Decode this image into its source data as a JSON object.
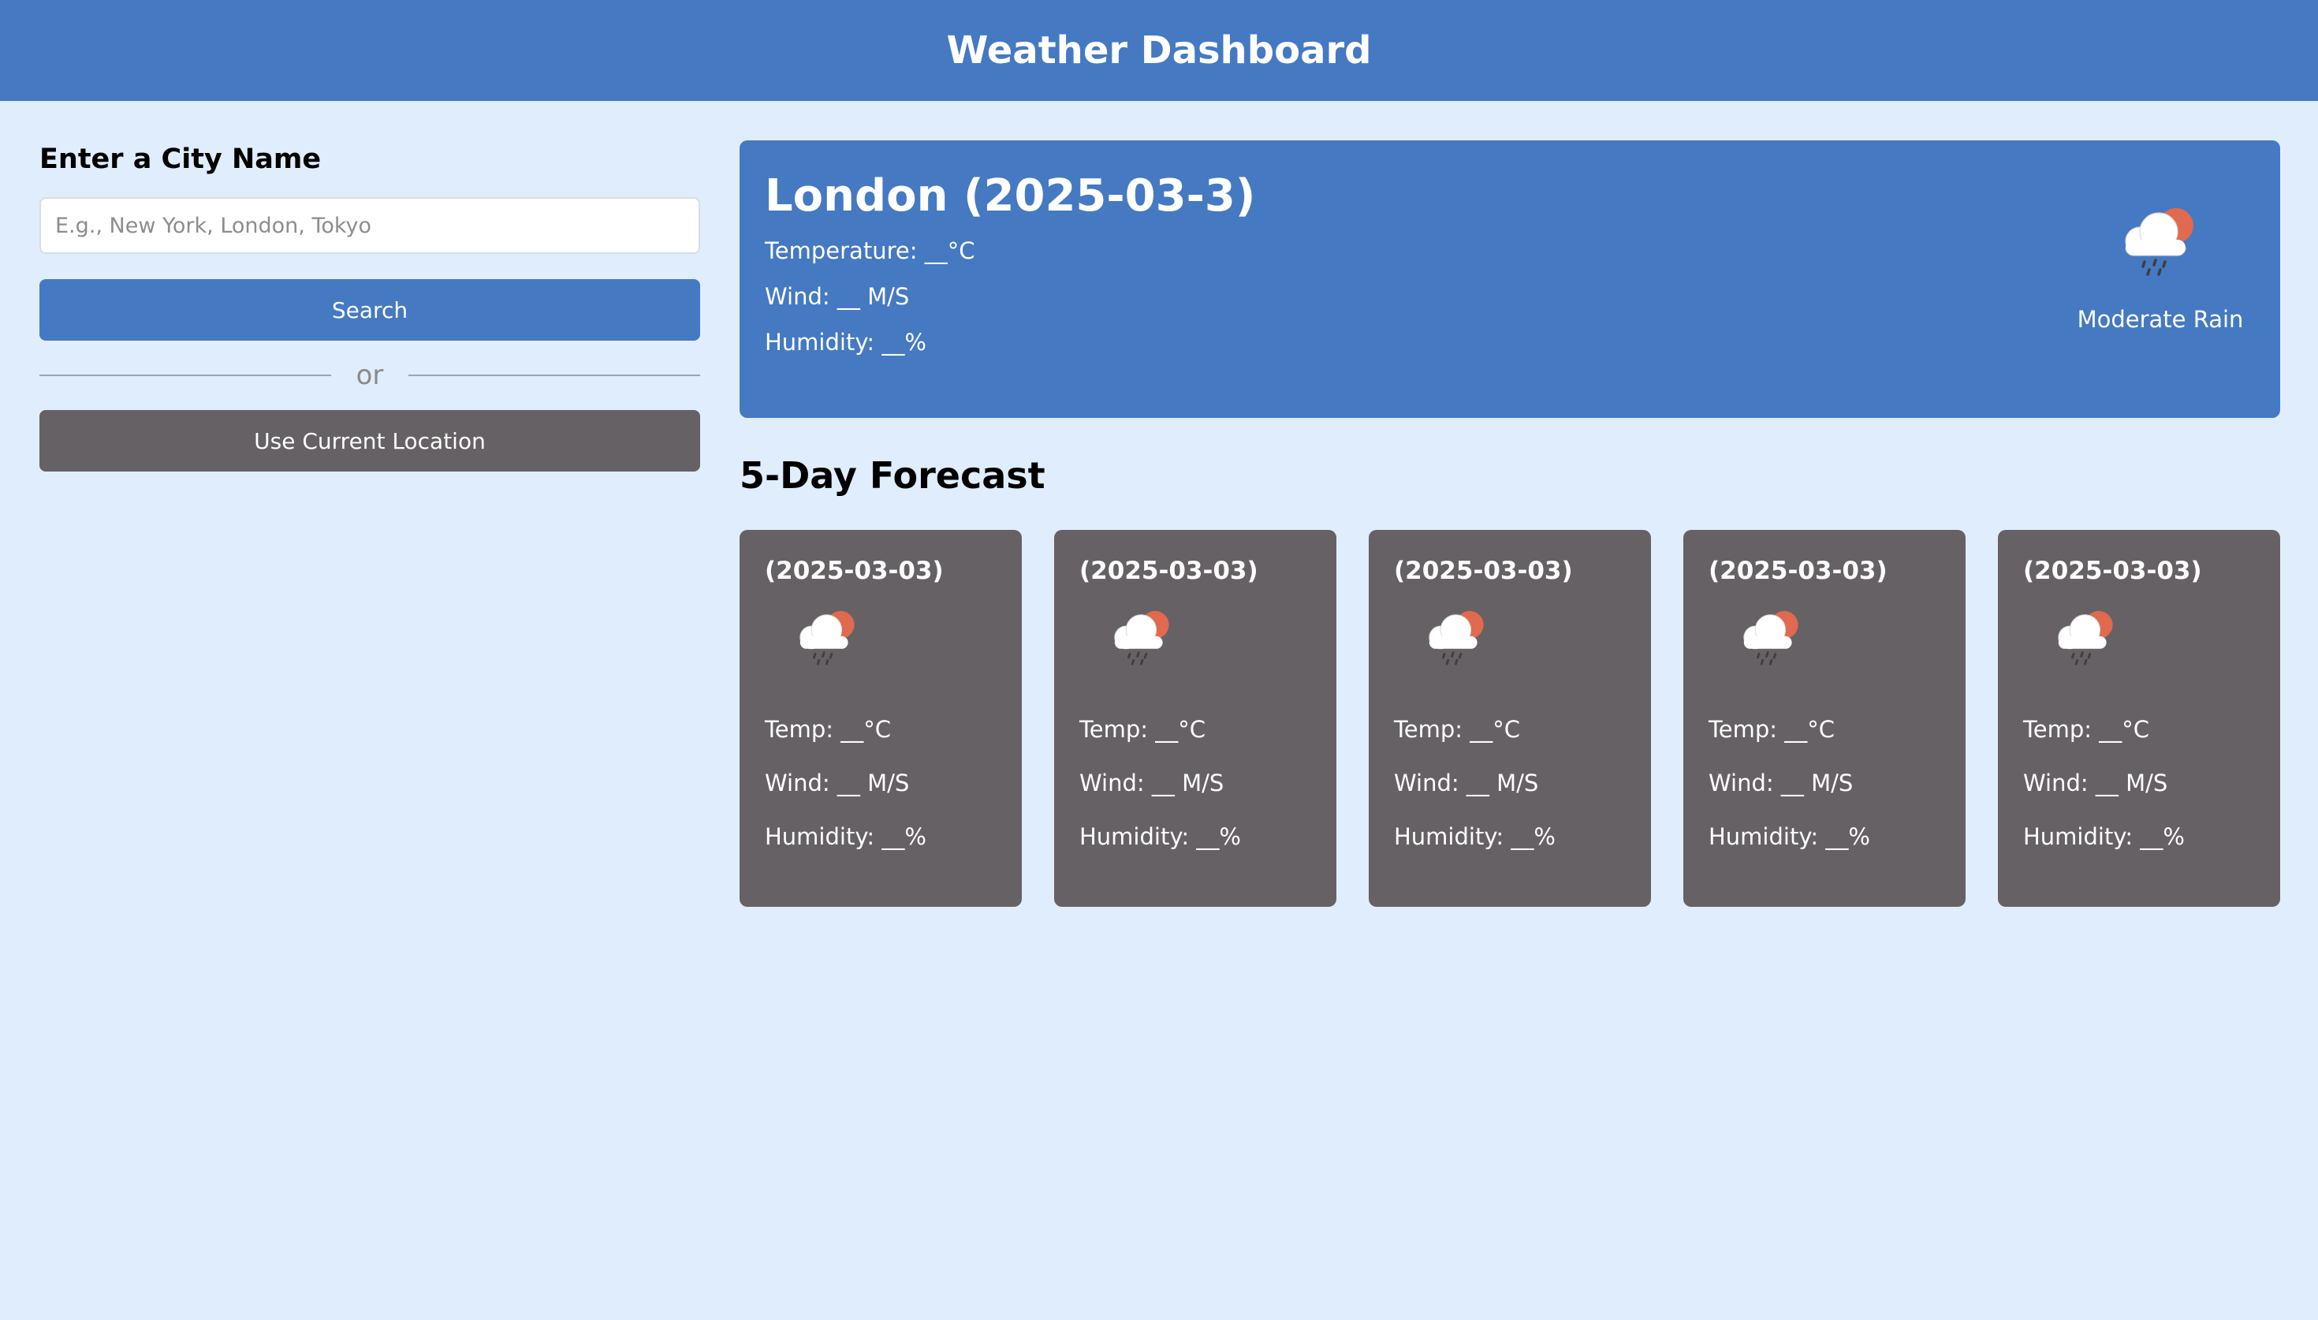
{
  "header": {
    "title": "Weather Dashboard"
  },
  "sidebar": {
    "heading": "Enter a City Name",
    "search_placeholder": "E.g., New York, London, Tokyo",
    "search_value": "",
    "search_button": "Search",
    "divider_text": "or",
    "location_button": "Use Current Location"
  },
  "current": {
    "title": "London (2025-03-3)",
    "temperature": "Temperature: __°C",
    "wind": "Wind: __ M/S",
    "humidity": "Humidity: __%",
    "icon": "rain-cloud-sun-icon",
    "condition": "Moderate Rain"
  },
  "forecast": {
    "title": "5-Day Forecast",
    "days": [
      {
        "date": "(2025-03-03)",
        "icon": "rain-cloud-sun-icon",
        "temp": "Temp: __°C",
        "wind": "Wind: __ M/S",
        "humidity": "Humidity: __%"
      },
      {
        "date": "(2025-03-03)",
        "icon": "rain-cloud-sun-icon",
        "temp": "Temp: __°C",
        "wind": "Wind: __ M/S",
        "humidity": "Humidity: __%"
      },
      {
        "date": "(2025-03-03)",
        "icon": "rain-cloud-sun-icon",
        "temp": "Temp: __°C",
        "wind": "Wind: __ M/S",
        "humidity": "Humidity: __%"
      },
      {
        "date": "(2025-03-03)",
        "icon": "rain-cloud-sun-icon",
        "temp": "Temp: __°C",
        "wind": "Wind: __ M/S",
        "humidity": "Humidity: __%"
      },
      {
        "date": "(2025-03-03)",
        "icon": "rain-cloud-sun-icon",
        "temp": "Temp: __°C",
        "wind": "Wind: __ M/S",
        "humidity": "Humidity: __%"
      }
    ]
  },
  "colors": {
    "primary": "#4579c2",
    "secondary": "#666164",
    "background": "#e0edfc",
    "sun": "#e0694f"
  }
}
